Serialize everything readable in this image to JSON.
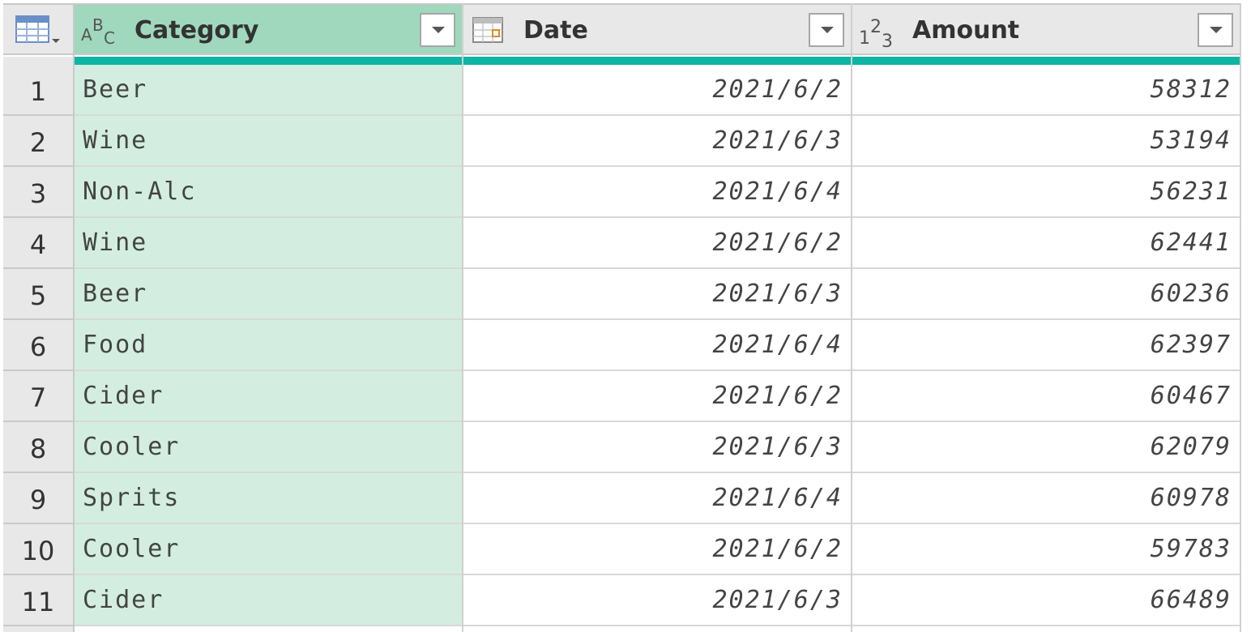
{
  "table": {
    "columns": [
      {
        "name": "Category",
        "type_icon": "text-type-icon",
        "type_glyph": "ABC",
        "selected": true
      },
      {
        "name": "Date",
        "type_icon": "date-type-icon",
        "selected": false
      },
      {
        "name": "Amount",
        "type_icon": "number-type-icon",
        "type_glyph": "123",
        "selected": false
      }
    ],
    "rows": [
      {
        "n": "1",
        "category": "Beer",
        "date": "2021/6/2",
        "amount": "58312"
      },
      {
        "n": "2",
        "category": "Wine",
        "date": "2021/6/3",
        "amount": "53194"
      },
      {
        "n": "3",
        "category": "Non-Alc",
        "date": "2021/6/4",
        "amount": "56231"
      },
      {
        "n": "4",
        "category": "Wine",
        "date": "2021/6/2",
        "amount": "62441"
      },
      {
        "n": "5",
        "category": "Beer",
        "date": "2021/6/3",
        "amount": "60236"
      },
      {
        "n": "6",
        "category": "Food",
        "date": "2021/6/4",
        "amount": "62397"
      },
      {
        "n": "7",
        "category": "Cider",
        "date": "2021/6/2",
        "amount": "60467"
      },
      {
        "n": "8",
        "category": "Cooler",
        "date": "2021/6/3",
        "amount": "62079"
      },
      {
        "n": "9",
        "category": "Sprits",
        "date": "2021/6/4",
        "amount": "60978"
      },
      {
        "n": "10",
        "category": "Cooler",
        "date": "2021/6/2",
        "amount": "59783"
      },
      {
        "n": "11",
        "category": "Cider",
        "date": "2021/6/3",
        "amount": "66489"
      }
    ]
  },
  "colors": {
    "selected_header": "#a0d8bd",
    "selected_column": "#d3eee1",
    "quality_bar": "#0eb5a4",
    "header_bg": "#e8e8e8"
  }
}
